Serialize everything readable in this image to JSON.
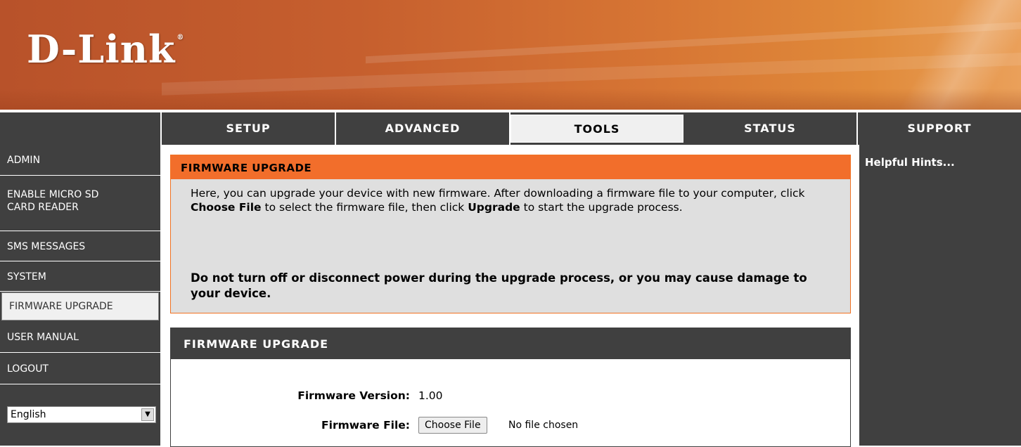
{
  "brand": {
    "logo_text": "D-Link",
    "reg_mark": "®"
  },
  "tabs": [
    {
      "label": "SETUP"
    },
    {
      "label": "ADVANCED"
    },
    {
      "label": "TOOLS"
    },
    {
      "label": "STATUS"
    },
    {
      "label": "SUPPORT"
    }
  ],
  "active_tab": "TOOLS",
  "sidebar": {
    "items": [
      {
        "label": "ADMIN"
      },
      {
        "label": "ENABLE MICRO SD CARD READER"
      },
      {
        "label": "SMS MESSAGES"
      },
      {
        "label": "SYSTEM"
      },
      {
        "label": "FIRMWARE UPGRADE"
      },
      {
        "label": "USER MANUAL"
      },
      {
        "label": "LOGOUT"
      }
    ],
    "active_item": "FIRMWARE UPGRADE",
    "language": {
      "selected": "English"
    }
  },
  "intro": {
    "title": "FIRMWARE UPGRADE",
    "text_1": "Here, you can upgrade your device with new firmware. After downloading a firmware file to your computer, click ",
    "choose_file_bold": "Choose File",
    "text_2": " to select the firmware file, then click ",
    "upgrade_bold": "Upgrade",
    "text_3": " to start the upgrade process.",
    "warning": "Do not turn off or disconnect power during the upgrade process, or you may cause damage to your device."
  },
  "upgrade_form": {
    "title": "FIRMWARE UPGRADE",
    "version_label": "Firmware Version:",
    "version_value": "1.00",
    "file_label": "Firmware File:",
    "choose_button": "Choose File",
    "file_status": "No file chosen"
  },
  "hints": {
    "title": "Helpful Hints..."
  },
  "colors": {
    "accent": "#f26e2b",
    "dark": "#404040",
    "panel": "#dfdfdf"
  }
}
